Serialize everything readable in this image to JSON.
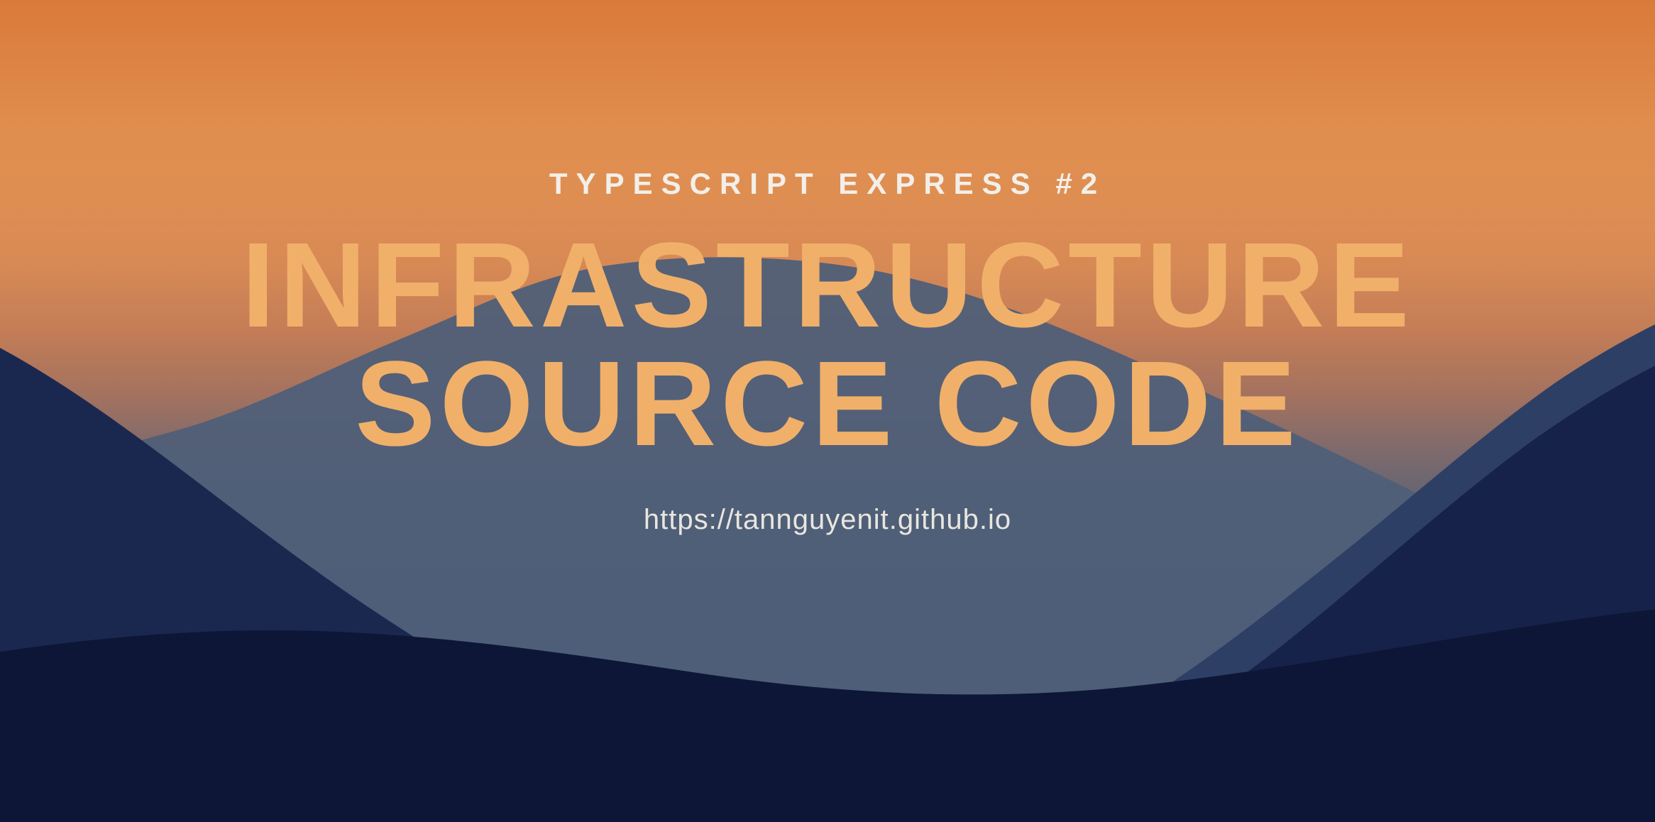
{
  "kicker": "TYPESCRIPT EXPRESS #2",
  "title_line1": "INFRASTRUCTURE",
  "title_line2": "SOURCE CODE",
  "url": "https://tannguyenit.github.io",
  "colors": {
    "title": "#f0b06a",
    "text": "#f2efe9",
    "sky_top": "#d97a3a",
    "sky_bottom": "#3f5472",
    "mountain_far": "#4a5a73",
    "mountain_mid": "#2e3f66",
    "mountain_near": "#16224a",
    "mountain_front": "#0d1636"
  }
}
